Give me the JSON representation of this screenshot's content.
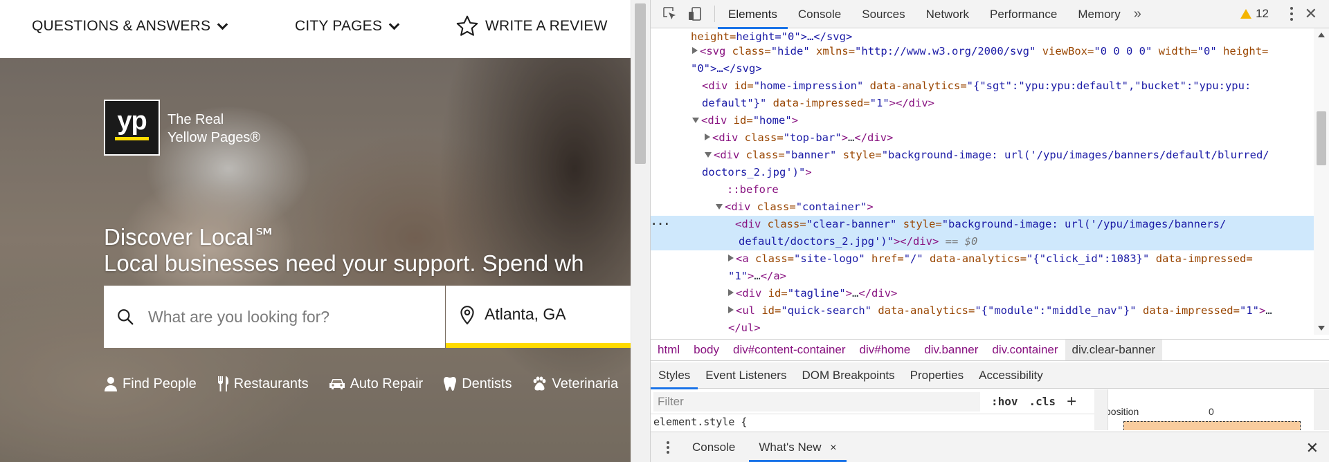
{
  "site": {
    "nav": {
      "questions_label": "QUESTIONS & ANSWERS",
      "city_label": "CITY PAGES",
      "review_label": "WRITE A REVIEW"
    },
    "logo": {
      "mark": "yp",
      "line1": "The Real",
      "line2": "Yellow Pages®"
    },
    "headline1": "Discover Local℠",
    "headline2": "Local businesses need your support. Spend wh",
    "search": {
      "what_placeholder": "What are you looking for?",
      "where_value": "Atlanta, GA"
    },
    "quick_search": [
      {
        "label": "Find People",
        "icon": "person-icon"
      },
      {
        "label": "Restaurants",
        "icon": "fork-knife-icon"
      },
      {
        "label": "Auto Repair",
        "icon": "car-icon"
      },
      {
        "label": "Dentists",
        "icon": "tooth-icon"
      },
      {
        "label": "Veterinaria",
        "icon": "paw-icon"
      }
    ],
    "brand_yellow": "#ffdb00"
  },
  "devtools": {
    "tabs": [
      "Elements",
      "Console",
      "Sources",
      "Network",
      "Performance",
      "Memory"
    ],
    "more": "»",
    "warnings_count": "12",
    "elements_lines": {
      "l0": {
        "v1": "height=\"0\">…</svg>"
      },
      "l1": {
        "a1": "class",
        "v1": "\"hide\"",
        "a2": "xmlns",
        "v2": "\"http://www.w3.org/2000/svg\"",
        "a3": "viewBox",
        "v3": "\"0 0 0 0\"",
        "a4": "width",
        "v4": "\"0\"",
        "a5": "height="
      },
      "l2": {
        "v1": "\"0\">…</svg>"
      },
      "l3": {
        "a1": "id",
        "v1": "\"home-impression\"",
        "a2": "data-analytics",
        "v2": "\"{\"sgt\":\"ypu:ypu:default\",\"bucket\":\"ypu:ypu:"
      },
      "l4": {
        "v1": "default\"}\"",
        "a1": "data-impressed",
        "v2": "\"1\""
      },
      "l5": {
        "a1": "id",
        "v1": "\"home\""
      },
      "l6": {
        "a1": "class",
        "v1": "\"top-bar\""
      },
      "l7": {
        "a1": "class",
        "v1": "\"banner\"",
        "a2": "style",
        "v2": "\"background-image: url('/ypu/images/banners/default/blurred/"
      },
      "l8": {
        "v1": "doctors_2.jpg')\""
      },
      "l9": {
        "t": "::before"
      },
      "l10": {
        "a1": "class",
        "v1": "\"container\""
      },
      "l11": {
        "a1": "class",
        "v1": "\"clear-banner\"",
        "a2": "style",
        "v2": "\"background-image: url('/ypu/images/banners/"
      },
      "l12": {
        "v1": "default/doctors_2.jpg')\"",
        "eq": "== $0"
      },
      "l13": {
        "a1": "class",
        "v1": "\"site-logo\"",
        "a2": "href",
        "v2": "\"/\"",
        "a3": "data-analytics",
        "v3": "\"{\"click_id\":1083}\"",
        "a4": "data-impressed="
      },
      "l14": {
        "v1": "\"1\""
      },
      "l15": {
        "a1": "id",
        "v1": "\"tagline\""
      },
      "l16": {
        "a1": "id",
        "v1": "\"quick-search\"",
        "a2": "data-analytics",
        "v2": "\"{\"module\":\"middle_nav\"}\"",
        "a3": "data-impressed",
        "v3": "\"1\""
      },
      "l17": {
        "t": "</ul>"
      }
    },
    "breadcrumbs": [
      "html",
      "body",
      "div#content-container",
      "div#home",
      "div.banner",
      "div.container",
      "div.clear-banner"
    ],
    "subtabs": [
      "Styles",
      "Event Listeners",
      "DOM Breakpoints",
      "Properties",
      "Accessibility"
    ],
    "styles": {
      "filter_placeholder": "Filter",
      "hov": ":hov",
      "cls": ".cls",
      "plus": "+",
      "element_style": "element.style {"
    },
    "box_model": {
      "position_label": "position",
      "position_value": "0"
    },
    "drawer": {
      "tabs": [
        "Console",
        "What's New"
      ],
      "close_x": "×"
    },
    "accent": "#1a73e8"
  }
}
